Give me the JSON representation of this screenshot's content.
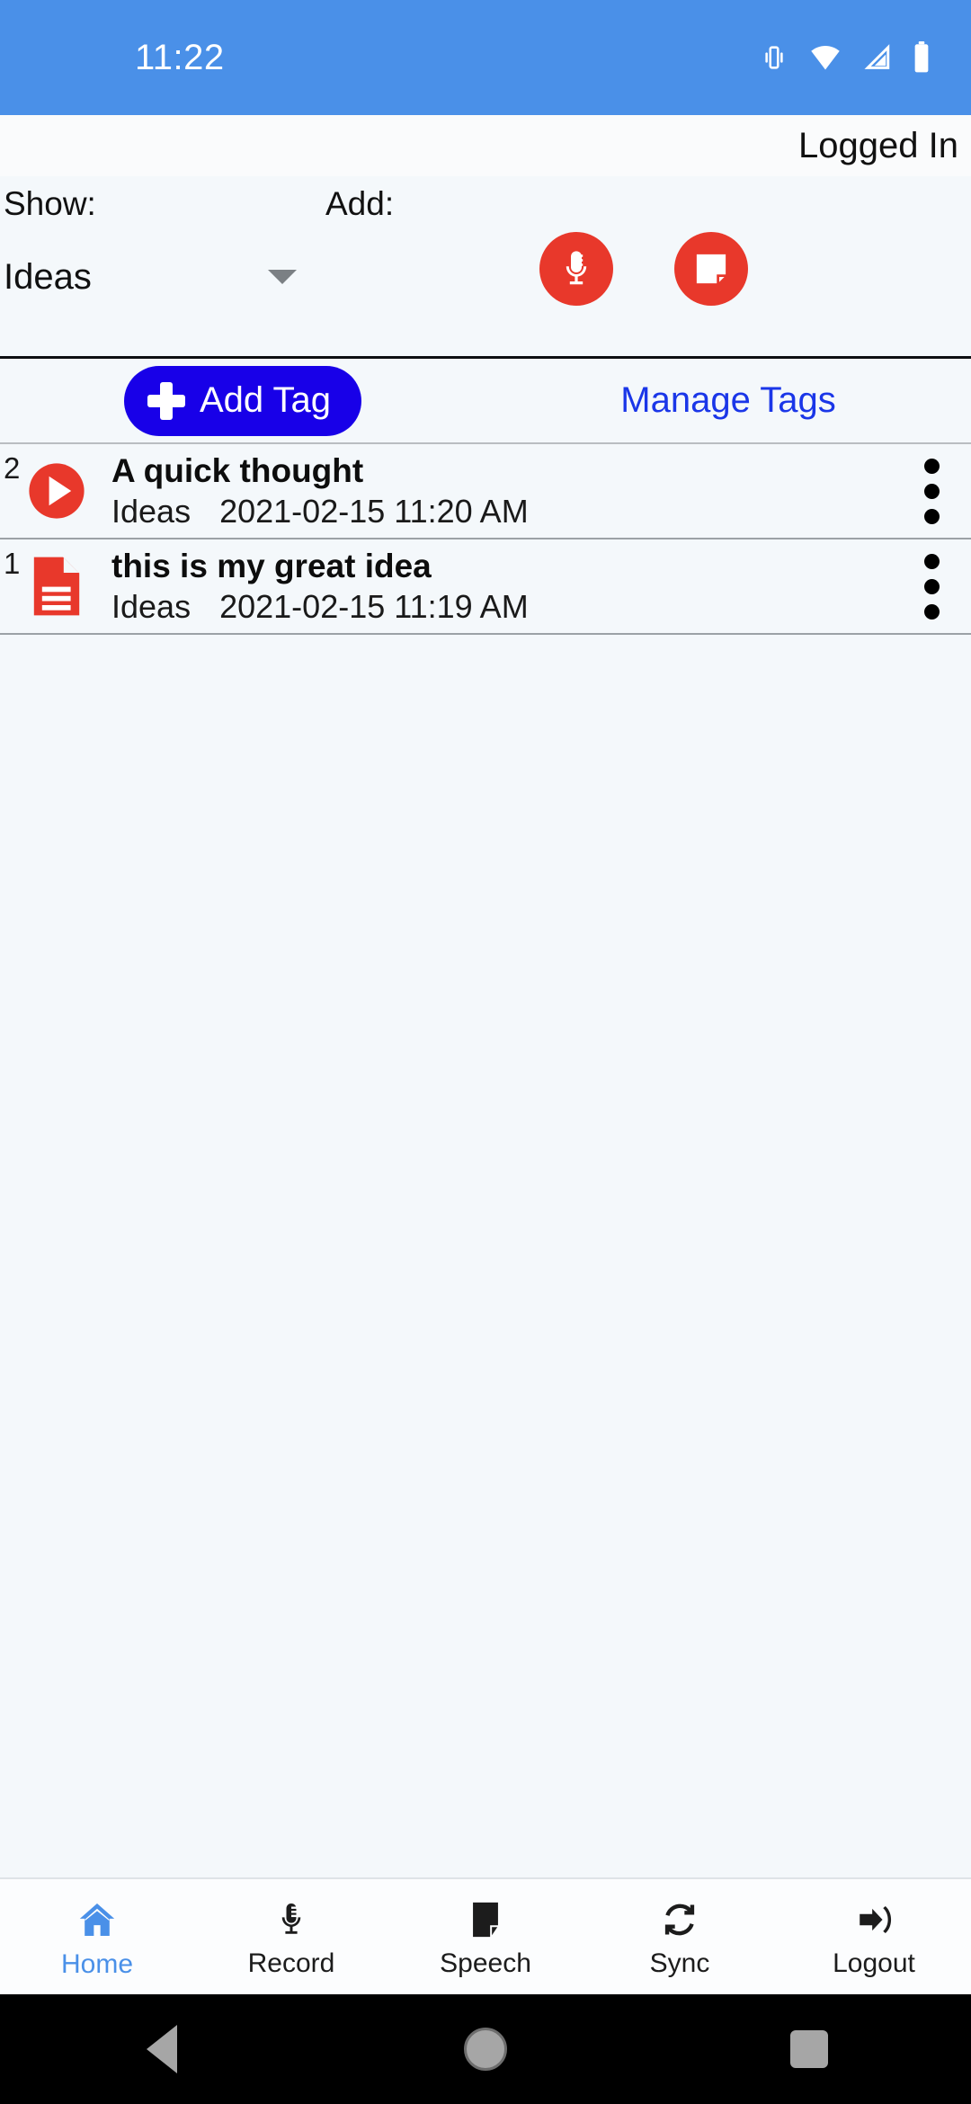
{
  "status_bar": {
    "time": "11:22",
    "icons": [
      "vibrate-icon",
      "wifi-icon",
      "cell-signal-icon",
      "battery-icon"
    ],
    "background_color": "#4a90e8"
  },
  "header": {
    "login_status": "Logged In"
  },
  "controls": {
    "show_label": "Show:",
    "add_label": "Add:",
    "filter_value": "Ideas",
    "filter_options": [
      "Ideas"
    ],
    "caret_icon": "chevron-down-icon",
    "add_record_icon": "microphone-icon",
    "add_note_icon": "note-icon",
    "fab_color": "#e8382b"
  },
  "tag_bar": {
    "add_tag_label": "Add Tag",
    "add_tag_icon": "plus-icon",
    "add_tag_color": "#1800e8",
    "manage_tags_label": "Manage Tags",
    "manage_tags_color": "#1a36e8"
  },
  "list": {
    "items": [
      {
        "index": "2",
        "icon": "play-circle-icon",
        "title": "A quick thought",
        "tag": "Ideas",
        "timestamp": "2021-02-15 11:20 AM",
        "more_icon": "more-vertical-icon"
      },
      {
        "index": "1",
        "icon": "document-icon",
        "title": "this is my great idea",
        "tag": "Ideas",
        "timestamp": "2021-02-15 11:19 AM",
        "more_icon": "more-vertical-icon"
      }
    ]
  },
  "bottom_nav": {
    "active_color": "#4a90e8",
    "items": [
      {
        "label": "Home",
        "icon": "home-icon"
      },
      {
        "label": "Record",
        "icon": "microphone-icon"
      },
      {
        "label": "Speech",
        "icon": "note-icon"
      },
      {
        "label": "Sync",
        "icon": "refresh-icon"
      },
      {
        "label": "Logout",
        "icon": "logout-icon"
      }
    ]
  },
  "system_nav": {
    "back_icon": "triangle-back-icon",
    "home_icon": "circle-home-icon",
    "recents_icon": "square-recents-icon"
  }
}
